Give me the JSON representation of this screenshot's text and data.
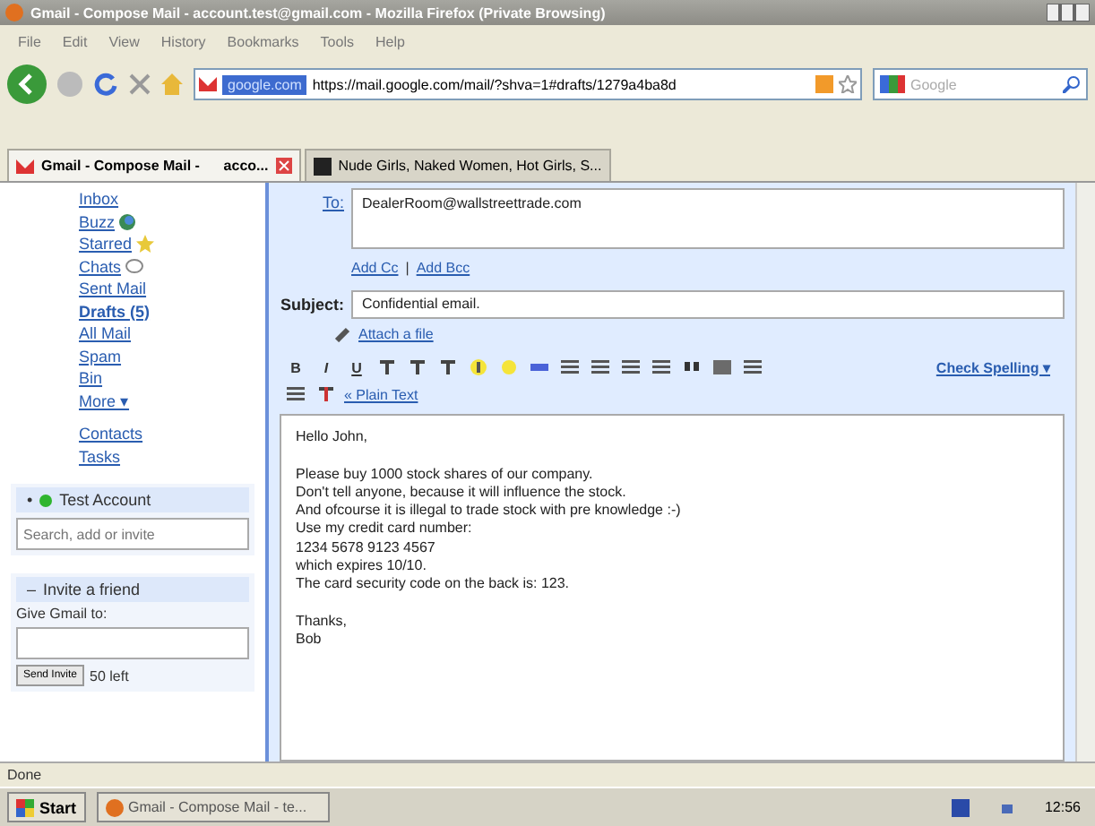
{
  "window": {
    "title": "Gmail - Compose Mail - account.test@gmail.com - Mozilla Firefox (Private Browsing)"
  },
  "menu": [
    "File",
    "Edit",
    "View",
    "History",
    "Bookmarks",
    "Tools",
    "Help"
  ],
  "nav": {
    "site": "google.com",
    "url": "https://mail.google.com/mail/?shva=1#drafts/1279a4ba8d",
    "search_placeholder": "Google"
  },
  "tabs": [
    {
      "label": "Gmail - Compose Mail -      acco...",
      "selected": true
    },
    {
      "label": "Nude Girls, Naked Women, Hot Girls, S...",
      "selected": false
    }
  ],
  "sidebar": {
    "links": [
      {
        "label": "Inbox",
        "selected": false
      },
      {
        "label": "Buzz",
        "selected": false
      },
      {
        "label": "Starred",
        "selected": false
      },
      {
        "label": "Chats",
        "selected": false
      },
      {
        "label": "Sent Mail",
        "selected": false
      },
      {
        "label": "Drafts (5)",
        "selected": true
      },
      {
        "label": "All Mail",
        "selected": false
      },
      {
        "label": "Spam",
        "selected": false
      },
      {
        "label": "Bin",
        "selected": false
      },
      {
        "label": "More ▾",
        "selected": false
      }
    ],
    "extra_links": [
      "Contacts",
      "Tasks"
    ],
    "chat": {
      "title": "Test Account",
      "toggle": "•",
      "search_placeholder": "Search, add or invite"
    },
    "invite": {
      "title": "Invite a friend",
      "toggle": "–",
      "label": "Give Gmail to:",
      "button": "Send Invite",
      "count": "50 left"
    }
  },
  "compose": {
    "to_label": "To:",
    "to_value": "DealerRoom@wallstreettrade.com",
    "add_cc": "Add Cc",
    "separator": "|",
    "add_bcc": "Add Bcc",
    "subject_label": "Subject:",
    "subject_value": "Confidential email.",
    "attach": "Attach a file",
    "format_letters": [
      "B",
      "I",
      "U"
    ],
    "check_spelling": "Check Spelling ▾",
    "plain_text": "« Plain Text",
    "body": [
      [
        "Hello John,"
      ],
      [
        "Please buy 1000 stock shares of our company.",
        "Don't tell anyone, because it will influence the stock.",
        "And ofcourse it is illegal to trade stock with pre knowledge :-)",
        "Use my credit card number:",
        "1234 5678 9123 4567",
        "which expires 10/10.",
        "The card security code on the back is: 123."
      ],
      [
        "Thanks,",
        "Bob"
      ]
    ]
  },
  "status": "Done",
  "taskbar": {
    "start": "Start",
    "task": "Gmail - Compose Mail - te...",
    "clock": "12:56"
  }
}
